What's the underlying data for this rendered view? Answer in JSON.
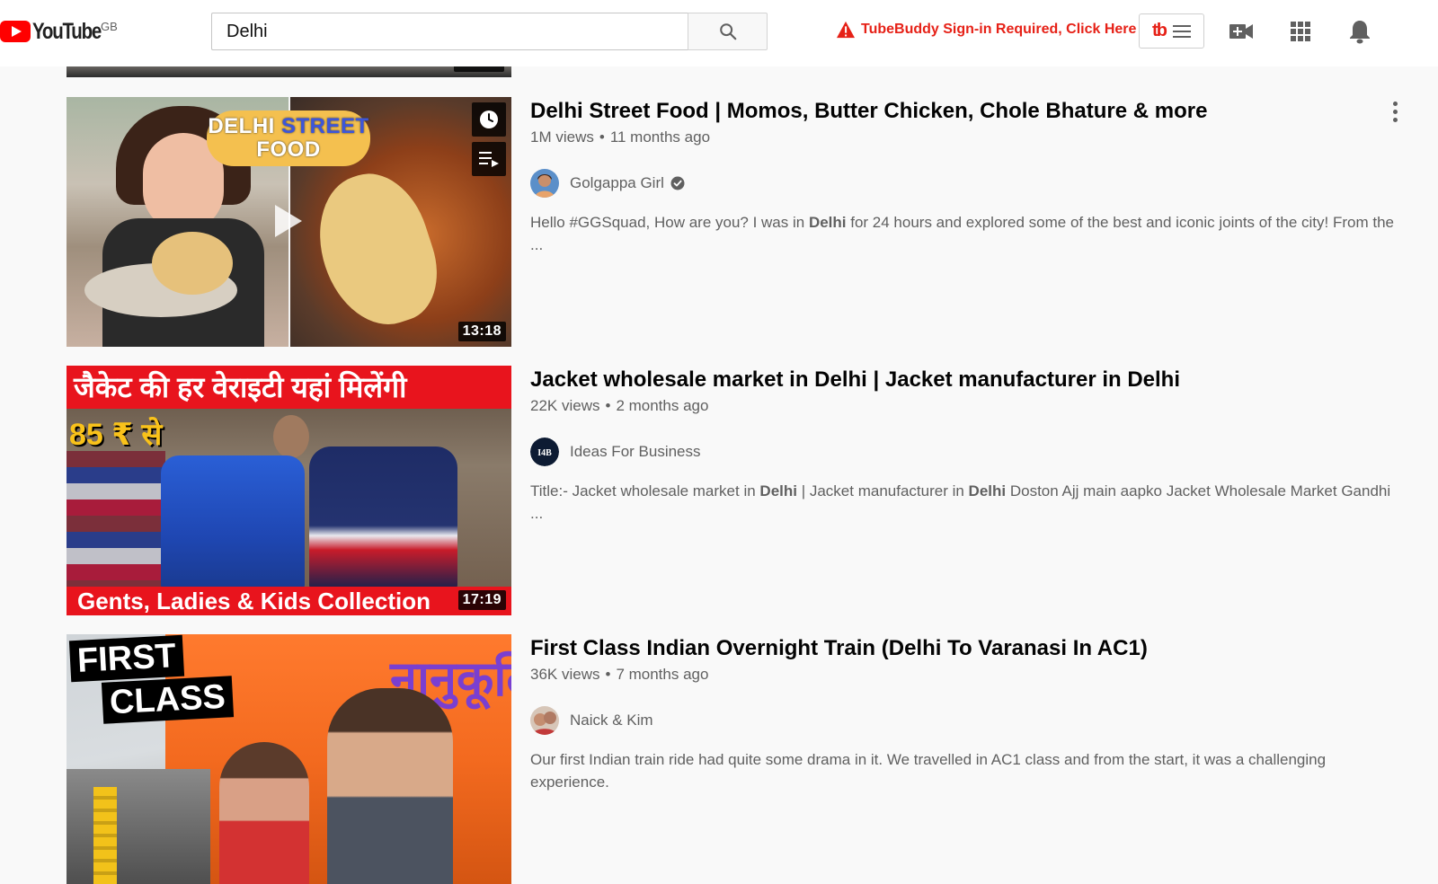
{
  "header": {
    "logo_text": "YouTube",
    "region": "GB",
    "search_value": "Delhi",
    "tubebuddy_alert": "TubeBuddy Sign-in Required, Click Here",
    "tubebuddy_mark": "tb",
    "icons": [
      "search-icon",
      "warning-icon",
      "create-video-icon",
      "apps-grid-icon",
      "notifications-bell-icon"
    ]
  },
  "videos": [
    {
      "title": "Delhi Street Food | Momos, Butter Chicken, Chole Bhature & more",
      "views": "1M views",
      "age": "11 months ago",
      "channel": "Golgappa Girl",
      "verified": true,
      "description_parts": [
        "Hello #GGSquad, How are you? I was in ",
        "Delhi",
        " for 24 hours and explored some of the best and iconic joints of the city! From the ..."
      ],
      "duration": "13:18",
      "thumb_text": [
        "DELHI",
        "STREET",
        "FOOD"
      ],
      "avatar_color": "#c98f6b"
    },
    {
      "title": "Jacket wholesale market in Delhi | Jacket manufacturer in Delhi",
      "views": "22K views",
      "age": "2 months ago",
      "channel": "Ideas For Business",
      "verified": false,
      "description_parts": [
        "Title:- Jacket wholesale market in ",
        "Delhi",
        " | Jacket manufacturer in ",
        "Delhi",
        " Doston Ajj main aapko Jacket Wholesale Market Gandhi ..."
      ],
      "duration": "17:19",
      "thumb_text": [
        "जैकेट की हर वेराइटी यहां मिलेंगी",
        "85 ₹ से",
        "Gents, Ladies & Kids Collection"
      ],
      "avatar_text": "I4B",
      "avatar_color": "#0d1b33"
    },
    {
      "title": "First Class Indian Overnight Train (Delhi To Varanasi In AC1)",
      "views": "36K views",
      "age": "7 months ago",
      "channel": "Naick & Kim",
      "verified": false,
      "description": "Our first Indian train ride had quite some drama in it. We travelled in AC1 class and from the start, it was a challenging experience.",
      "thumb_text": [
        "FIRST",
        "CLASS",
        "नानुकूलि"
      ],
      "avatar_color": "#b07a63"
    }
  ],
  "colors": {
    "brand_red": "#ff0000",
    "alert_red": "#e62117",
    "meta_gray": "#606060"
  }
}
